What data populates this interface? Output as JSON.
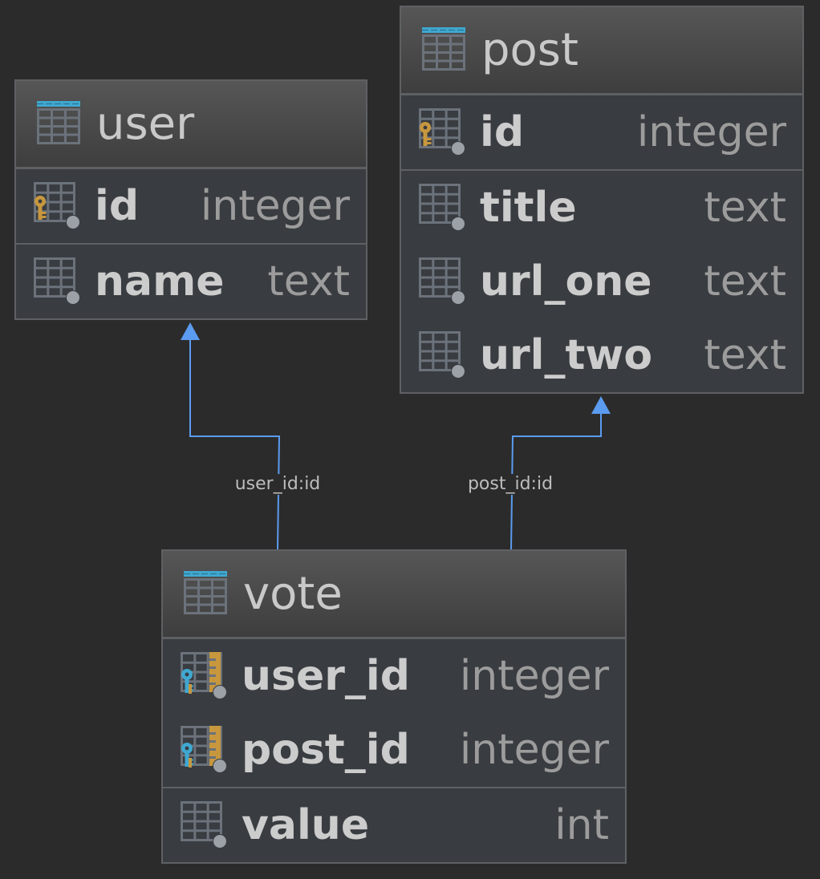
{
  "tables": {
    "user": {
      "name": "user",
      "sections": [
        [
          {
            "name": "id",
            "type": "integer",
            "icon": "primary-key-column-icon"
          }
        ],
        [
          {
            "name": "name",
            "type": "text",
            "icon": "column-icon"
          }
        ]
      ]
    },
    "post": {
      "name": "post",
      "sections": [
        [
          {
            "name": "id",
            "type": "integer",
            "icon": "primary-key-column-icon"
          }
        ],
        [
          {
            "name": "title",
            "type": "text",
            "icon": "column-icon"
          },
          {
            "name": "url_one",
            "type": "text",
            "icon": "column-icon"
          },
          {
            "name": "url_two",
            "type": "text",
            "icon": "column-icon"
          }
        ]
      ]
    },
    "vote": {
      "name": "vote",
      "sections": [
        [
          {
            "name": "user_id",
            "type": "integer",
            "icon": "primary-foreign-key-column-icon"
          },
          {
            "name": "post_id",
            "type": "integer",
            "icon": "primary-foreign-key-column-icon"
          }
        ],
        [
          {
            "name": "value",
            "type": "int",
            "icon": "column-icon"
          }
        ]
      ]
    }
  },
  "relations": [
    {
      "name": "vote-user-relation",
      "label": "user_id:id",
      "from": "vote",
      "to": "user"
    },
    {
      "name": "vote-post-relation",
      "label": "post_id:id",
      "from": "vote",
      "to": "post"
    }
  ],
  "colors": {
    "background": "#2b2b2b",
    "table_body": "#393c40",
    "table_border": "#5e6063",
    "table_icon_header": "#3fa8d0",
    "primary_key": "#c7973e",
    "foreign_key": "#3fa8d0",
    "relation_line": "#5b9bf0",
    "column_name": "#cccccc",
    "column_type": "#9c9c9c"
  }
}
